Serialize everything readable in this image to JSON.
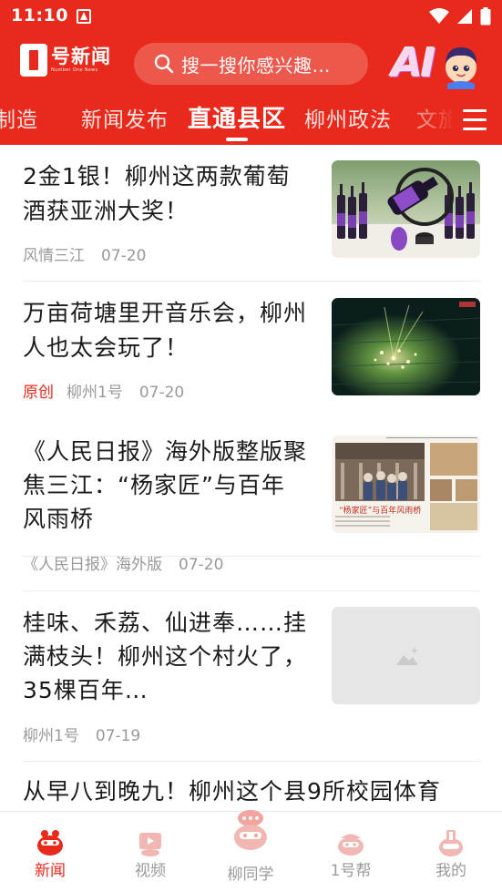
{
  "status_bar": {
    "time": "11:10"
  },
  "header": {
    "logo_cn": "号新闻",
    "logo_en": "Number One News",
    "search_placeholder": "搜一搜你感兴趣…",
    "ai_label": "AI"
  },
  "tabs": [
    {
      "label": "制造"
    },
    {
      "label": "新闻发布"
    },
    {
      "label": "直通县区",
      "active": true
    },
    {
      "label": "柳州政法"
    },
    {
      "label": "文旅"
    }
  ],
  "articles": [
    {
      "title": "2金1银！柳州这两款葡萄酒获亚洲大奖！",
      "source": "风情三江",
      "date": "07-20",
      "image": "wine-bottles-photo"
    },
    {
      "title": "万亩荷塘里开音乐会，柳州人也太会玩了！",
      "tag": "原创",
      "source": "柳州1号",
      "date": "07-20",
      "image": "night-concert-photo"
    },
    {
      "title": "《人民日报》海外版整版聚焦三江：“杨家匠”与百年风雨桥",
      "source": "《人民日报》海外版",
      "date": "07-20",
      "image": "newspaper-page-photo",
      "image_caption": "“杨家匠”与百年风雨桥"
    },
    {
      "title": "桂味、禾荔、仙进奉……挂满枝头！柳州这个村火了，35棵百年…",
      "source": "柳州1号",
      "date": "07-19",
      "image": "image-placeholder"
    },
    {
      "title": "从早八到晚九！柳州这个县9所校园体育"
    }
  ],
  "bottom_nav": [
    {
      "label": "新闻",
      "icon": "news-mascot-icon",
      "active": true
    },
    {
      "label": "视频",
      "icon": "video-mascot-icon"
    },
    {
      "label": "柳同学",
      "icon": "assistant-mascot-icon"
    },
    {
      "label": "1号帮",
      "icon": "help-mascot-icon"
    },
    {
      "label": "我的",
      "icon": "profile-mascot-icon"
    }
  ],
  "colors": {
    "brand": "#e8291c",
    "meta_gray": "#999999",
    "nav_gray": "#9a9a9a"
  }
}
